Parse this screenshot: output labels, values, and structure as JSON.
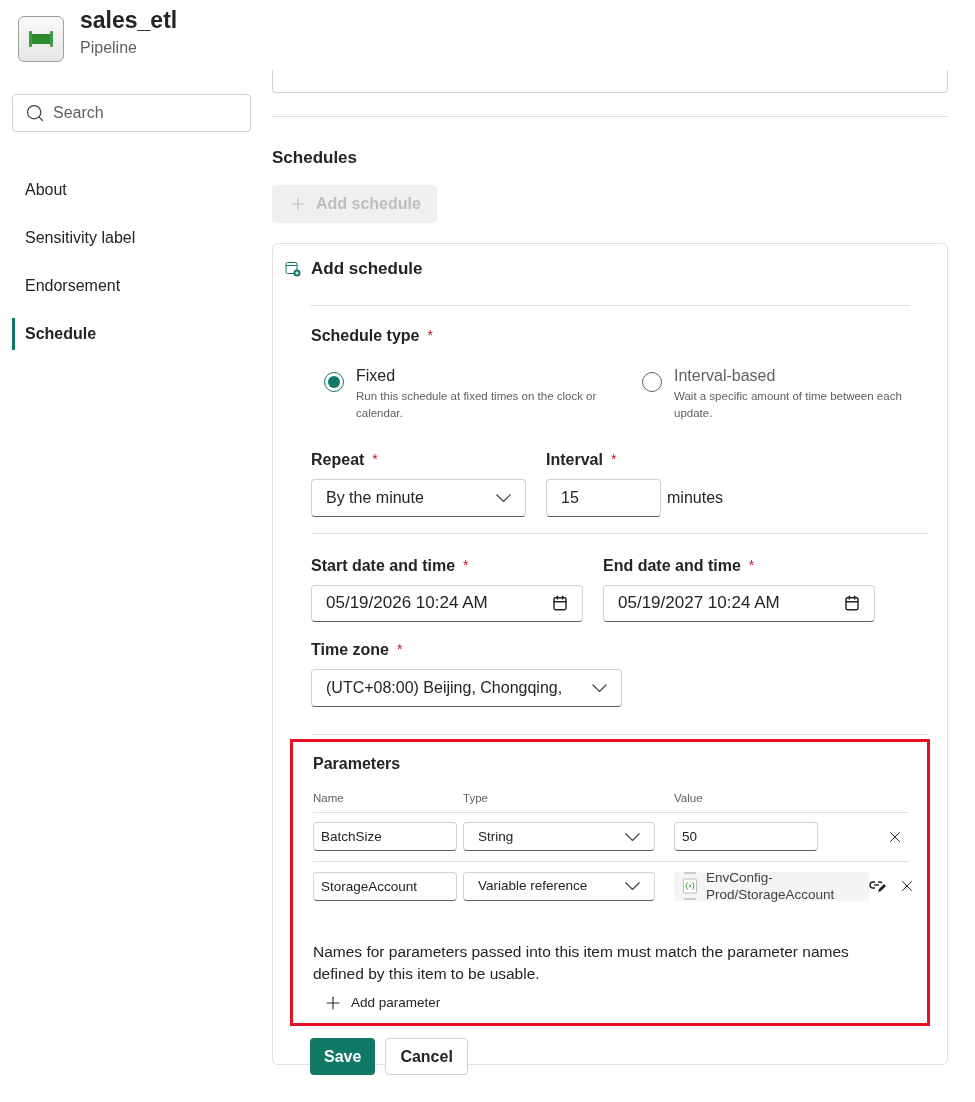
{
  "header": {
    "title": "sales_etl",
    "subtitle": "Pipeline"
  },
  "sidebar": {
    "search_placeholder": "Search",
    "items": [
      {
        "label": "About",
        "selected": false
      },
      {
        "label": "Sensitivity label",
        "selected": false
      },
      {
        "label": "Endorsement",
        "selected": false
      },
      {
        "label": "Schedule",
        "selected": true
      }
    ]
  },
  "schedules": {
    "heading": "Schedules",
    "add_button": {
      "label": "Add schedule",
      "disabled": true
    },
    "panel": {
      "title": "Add schedule",
      "schedule_type": {
        "label": "Schedule type",
        "required_mark": "*",
        "options": [
          {
            "label": "Fixed",
            "description": "Run this schedule at fixed times on the clock or calendar.",
            "selected": true
          },
          {
            "label": "Interval-based",
            "description": "Wait a specific amount of time between each update.",
            "selected": false
          }
        ]
      },
      "repeat": {
        "label": "Repeat",
        "required_mark": "*",
        "value": "By the minute"
      },
      "interval": {
        "label": "Interval",
        "required_mark": "*",
        "value": "15",
        "unit": "minutes"
      },
      "start": {
        "label": "Start date and time",
        "required_mark": "*",
        "value": "05/19/2026 10:24 AM"
      },
      "end": {
        "label": "End date and time",
        "required_mark": "*",
        "value": "05/19/2027 10:24 AM"
      },
      "time_zone": {
        "label": "Time zone",
        "required_mark": "*",
        "value": "(UTC+08:00) Beijing, Chongqing,"
      },
      "parameters": {
        "highlighted": true,
        "heading": "Parameters",
        "columns": [
          "Name",
          "Type",
          "Value"
        ],
        "rows": [
          {
            "name": "BatchSize",
            "type": "String",
            "kind": "text",
            "value": "50"
          },
          {
            "name": "StorageAccount",
            "type": "Variable reference",
            "kind": "reference",
            "value": "EnvConfig-Prod/StorageAccount"
          }
        ],
        "note": "Names for parameters passed into this item must match the parameter names defined by this item to be usable.",
        "add_label": "Add parameter"
      },
      "buttons": {
        "save": "Save",
        "cancel": "Cancel"
      }
    }
  }
}
